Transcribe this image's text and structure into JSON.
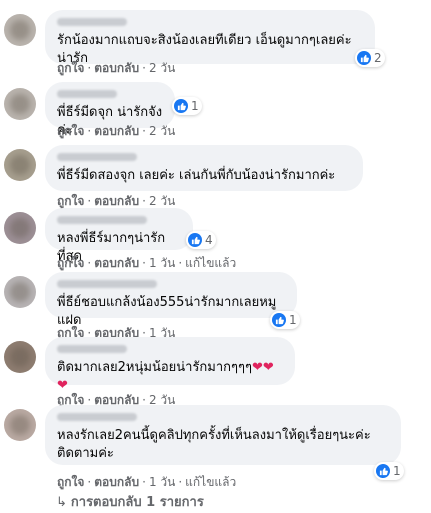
{
  "comments": [
    {
      "text": "รักน้องมากแถบจะสิงน้องเลยทีเดียว เอ็นดูมากๆเลยค่ะ น่ารัก",
      "reactions": "2",
      "like": "ถูกใจ",
      "reply": "ตอบกลับ",
      "time": "2 วัน",
      "edited": ""
    },
    {
      "text": "พี่ธีร์มีดจุก น่ารักจังค่ะ",
      "reactions": "1",
      "like": "ถูกใจ",
      "reply": "ตอบกลับ",
      "time": "2 วัน",
      "edited": ""
    },
    {
      "text": "พี่ธีร์มีดสองจุก เลยค่ะ เล่นกันพี่กับน้องน่ารักมากค่ะ",
      "reactions": "",
      "like": "ถูกใจ",
      "reply": "ตอบกลับ",
      "time": "2 วัน",
      "edited": ""
    },
    {
      "text": "หลงพี่ธีร์มากๆน่ารักที่สุด",
      "reactions": "4",
      "like": "ถูกใจ",
      "reply": "ตอบกลับ",
      "time": "1 วัน",
      "edited": "แก้ไขแล้ว"
    },
    {
      "text": "พี่ธีย์ชอบแกล้งน้อง555น่ารักมากเลยหมูแฝด",
      "reactions": "1",
      "like": "ถูกใจ",
      "reply": "ตอบกลับ",
      "time": "1 วัน",
      "edited": ""
    },
    {
      "text": "ติดมากเลย2หนุ่มน้อยน่ารักมากๆๆๆ",
      "hearts": "❤❤❤",
      "reactions": "",
      "like": "ถูกใจ",
      "reply": "ตอบกลับ",
      "time": "2 วัน",
      "edited": ""
    },
    {
      "text": "หลงรักเลย2คนนี้ดูคลิปทุกครั้งที่เห็นลงมาให้ดูเรื่อยๆนะค่ะ\nติดตามค่ะ",
      "reactions": "1",
      "like": "ถูกใจ",
      "reply": "ตอบกลับ",
      "time": "1 วัน",
      "edited": "แก้ไขแล้ว"
    }
  ],
  "replies_link": "การตอบกลับ 1 รายการ",
  "colors": {
    "like_blue": "#1877f2",
    "bubble": "#f0f2f5",
    "meta": "#65676b",
    "heart": "#e0245e"
  },
  "icons": {
    "reaction": "like-icon",
    "reply_arrow": "reply-arrow-icon",
    "avatar": "avatar"
  }
}
